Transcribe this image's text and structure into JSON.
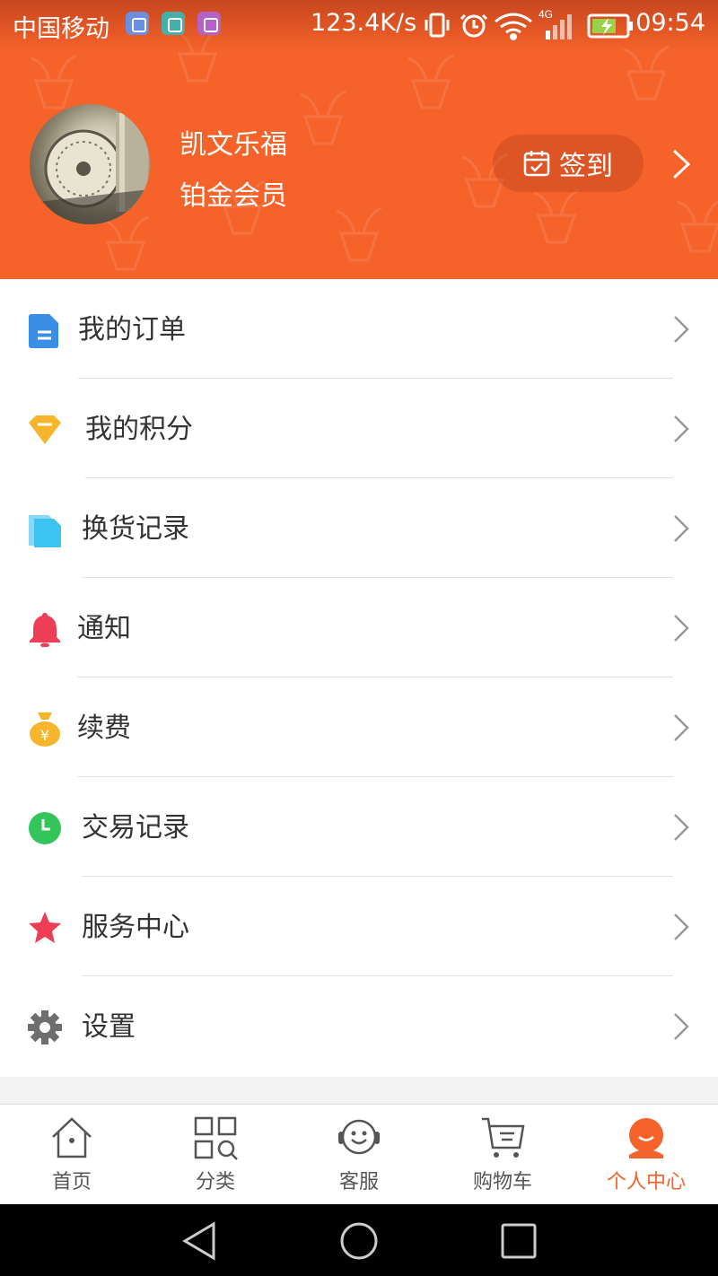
{
  "status_bar": {
    "carrier": "中国移动",
    "speed": "123.4K/s",
    "network": "4G",
    "time": "09:54"
  },
  "profile": {
    "username": "凯文乐福",
    "member_level": "铂金会员",
    "signin_label": "签到"
  },
  "menu": {
    "items": [
      {
        "label": "我的订单",
        "icon": "document-icon",
        "color": "#3a8ee6"
      },
      {
        "label": "我的积分",
        "icon": "diamond-icon",
        "color": "#f7b52c"
      },
      {
        "label": "换货记录",
        "icon": "files-icon",
        "color": "#3dc3ef"
      },
      {
        "label": "通知",
        "icon": "bell-icon",
        "color": "#ee3e55"
      },
      {
        "label": "续费",
        "icon": "money-bag-icon",
        "color": "#f7b52c"
      },
      {
        "label": "交易记录",
        "icon": "clock-icon",
        "color": "#33c45a"
      },
      {
        "label": "服务中心",
        "icon": "star-icon",
        "color": "#ee3e55"
      },
      {
        "label": "设置",
        "icon": "gear-icon",
        "color": "#6e6e6e"
      }
    ]
  },
  "tabbar": {
    "tabs": [
      {
        "label": "首页",
        "icon": "home-icon"
      },
      {
        "label": "分类",
        "icon": "category-icon"
      },
      {
        "label": "客服",
        "icon": "customer-service-icon"
      },
      {
        "label": "购物车",
        "icon": "cart-icon"
      },
      {
        "label": "个人中心",
        "icon": "user-icon",
        "active": true
      }
    ]
  },
  "colors": {
    "brand": "#f5622a",
    "text": "#333333",
    "divider": "#e2e2e2"
  }
}
